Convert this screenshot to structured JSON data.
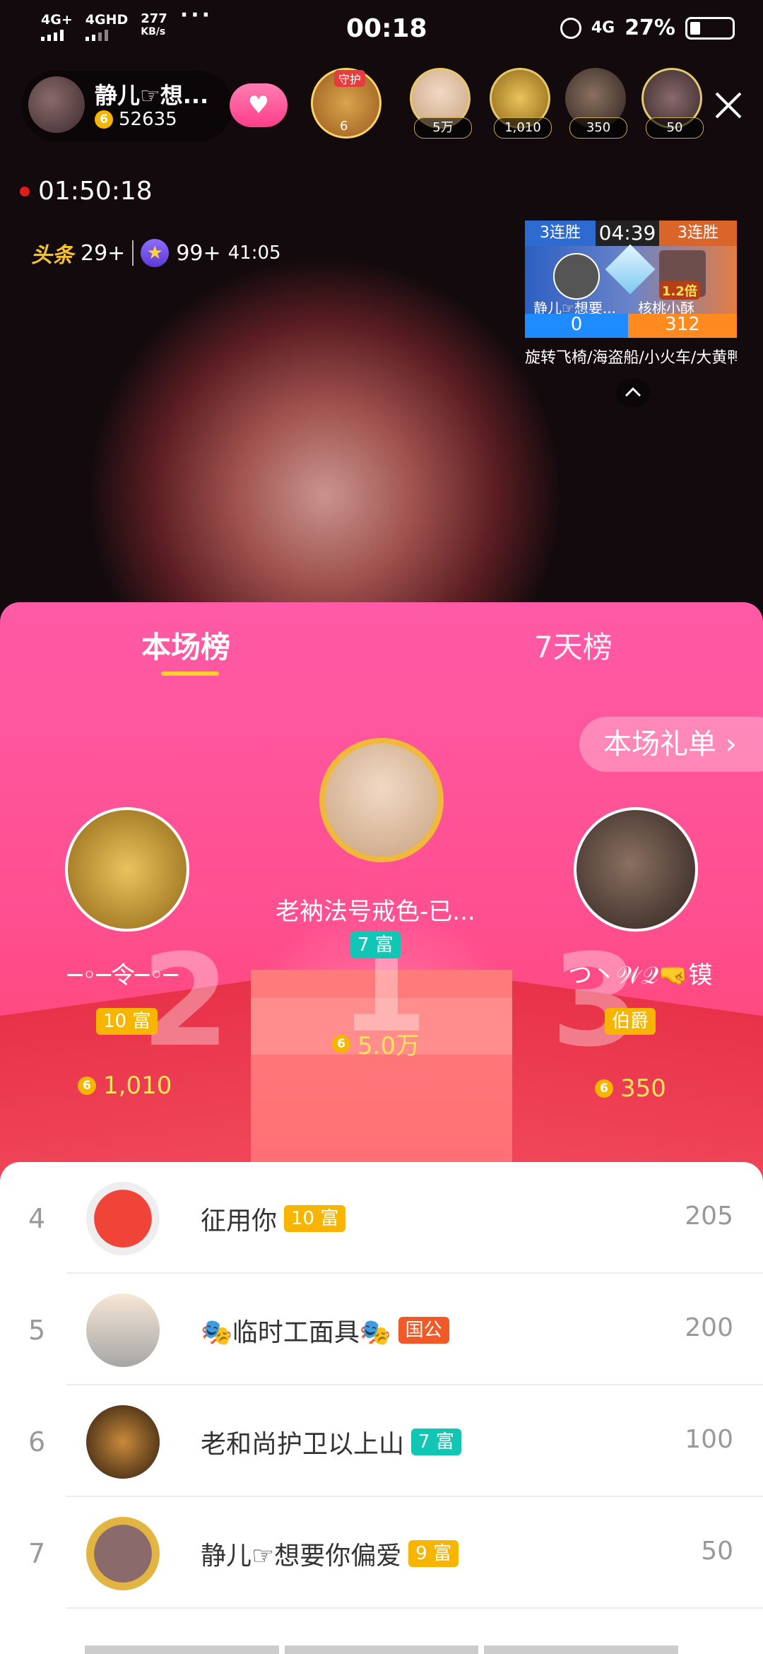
{
  "status": {
    "net1": "4G+",
    "net2": "4GHD",
    "speed": "277",
    "speed_unit": "KB/s",
    "time": "00:18",
    "net3": "4G",
    "battery": "27%"
  },
  "host": {
    "name": "静儿☞想...",
    "coins": "52635",
    "guard_tag": "守护",
    "guard_level": "6"
  },
  "viewers": [
    {
      "value": "5万"
    },
    {
      "value": "1,010"
    },
    {
      "value": "350"
    },
    {
      "value": "50"
    }
  ],
  "live": {
    "duration": "01:50:18",
    "toutiao_label": "头条",
    "toutiao_count": "29+",
    "star_count": "99+",
    "star_time": "41:05"
  },
  "pk": {
    "left_streak": "3连胜",
    "timer": "04:39",
    "right_streak": "3连胜",
    "left_name": "静儿☞想要...",
    "right_name": "核桃小酥",
    "multiplier": "1.2倍",
    "left_score": "0",
    "right_score": "312",
    "footer": "旋转飞椅/海盗船/小火车/大黄鸭"
  },
  "ranking": {
    "tabs": [
      "本场榜",
      "7天榜"
    ],
    "gift_list_label": "本场礼单",
    "top": [
      {
        "rank": 1,
        "name": "老衲法号戒色-已...",
        "badge": "7 富",
        "amount": "5.0万"
      },
      {
        "rank": 2,
        "name": "─◦─令─◦─",
        "badge": "10 富",
        "amount": "1,010"
      },
      {
        "rank": 3,
        "name": "つ丶𝒲𝒬🤜镆",
        "badge": "伯爵",
        "amount": "350"
      }
    ],
    "podium_numbers": [
      "2",
      "1",
      "3"
    ],
    "rows": [
      {
        "rank": "4",
        "name": "征用你",
        "badge": "10 富",
        "value": "205"
      },
      {
        "rank": "5",
        "name": "🎭临时工面具🎭",
        "badge": "国公",
        "value": "200"
      },
      {
        "rank": "6",
        "name": "老和尚护卫以上山",
        "badge": "7 富",
        "value": "100"
      },
      {
        "rank": "7",
        "name": "静儿☞想要你偏爱",
        "badge": "9 富",
        "value": "50"
      }
    ]
  },
  "colors": {
    "sheet_top": "#ff5aa6",
    "sheet_bottom": "#ff3e56",
    "accent_yellow": "#ffd02b",
    "badge_gold": "#f7b500",
    "badge_teal": "#12c6b5"
  }
}
